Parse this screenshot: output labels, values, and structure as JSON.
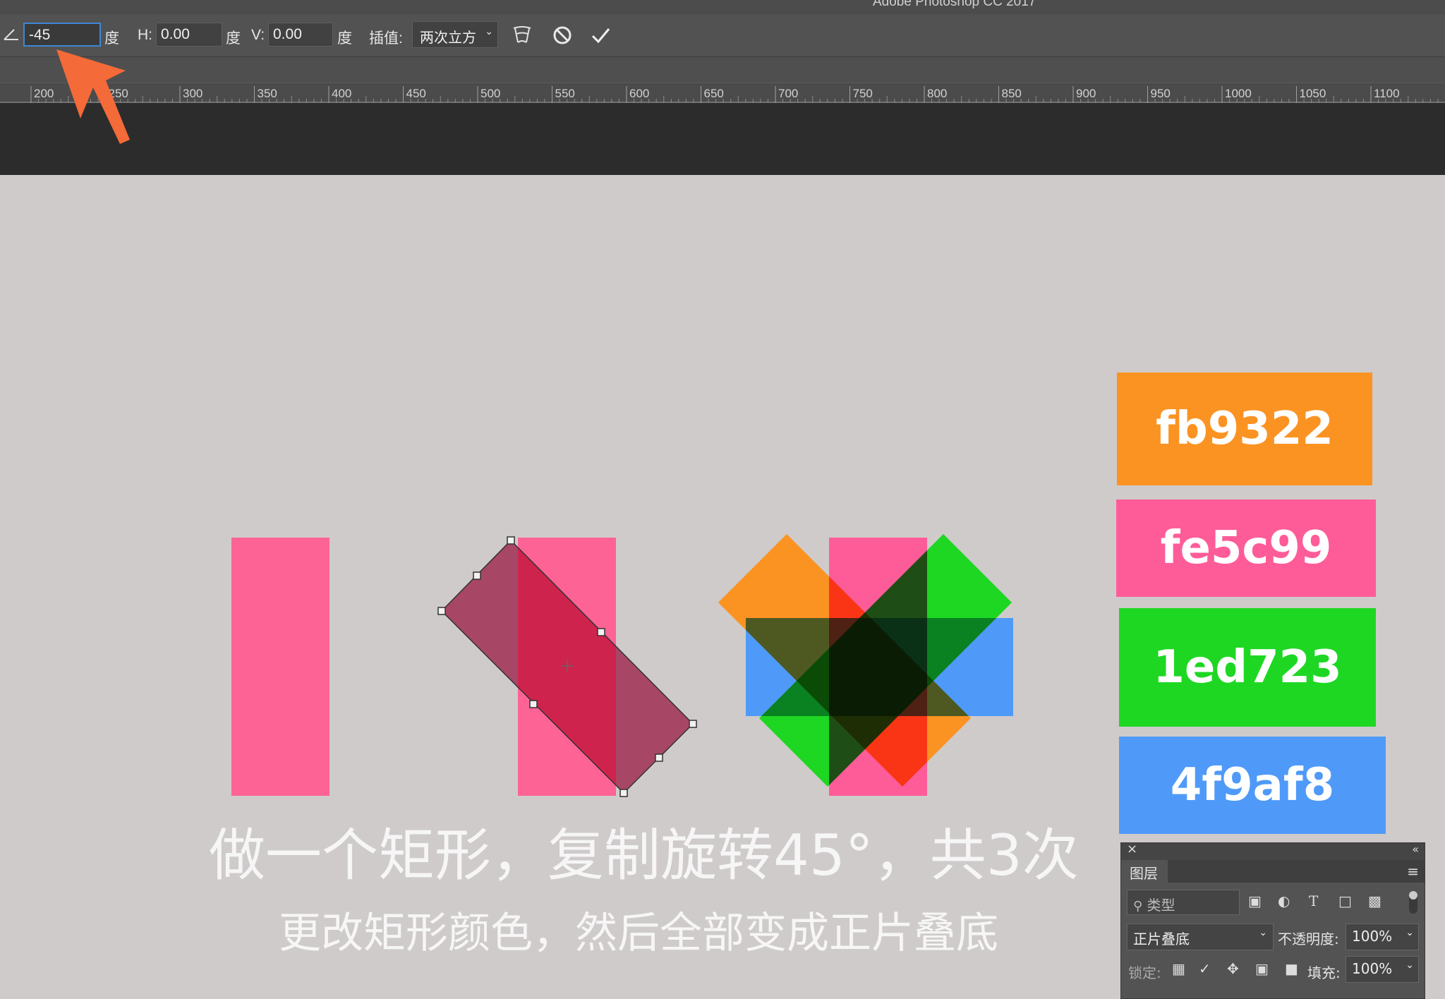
{
  "app": {
    "title": "Adobe Photoshop CC 2017"
  },
  "options_bar": {
    "angle_value": "-45",
    "angle_unit": "度",
    "h_label": "H:",
    "h_value": "0.00",
    "h_unit": "度",
    "v_label": "V:",
    "v_value": "0.00",
    "v_unit": "度",
    "interp_label": "插值:",
    "interp_value": "两次立方"
  },
  "ruler": {
    "ticks": [
      "200",
      "250",
      "300",
      "350",
      "400",
      "450",
      "500",
      "550",
      "600",
      "650",
      "700",
      "750",
      "800",
      "850",
      "900",
      "950",
      "1000",
      "1050",
      "1100"
    ]
  },
  "canvas": {
    "caption_main": "做一个矩形，复制旋转45°，共3次",
    "caption_sub": "更改矩形颜色，然后全部变成正片叠底",
    "swatches": [
      {
        "label": "fb9322",
        "color": "#fb9322"
      },
      {
        "label": "fe5c99",
        "color": "#fe5c99"
      },
      {
        "label": "1ed723",
        "color": "#1ed723"
      },
      {
        "label": "4f9af8",
        "color": "#4f9af8"
      }
    ],
    "rect_color": "#fe6395",
    "arrow_color": "#f46a38"
  },
  "layers_panel": {
    "tab_label": "图层",
    "search_placeholder": "类型",
    "blend_mode": "正片叠底",
    "opacity_label": "不透明度:",
    "opacity_value": "100%",
    "lock_label": "锁定:",
    "fill_label": "填充:",
    "fill_value": "100%"
  }
}
